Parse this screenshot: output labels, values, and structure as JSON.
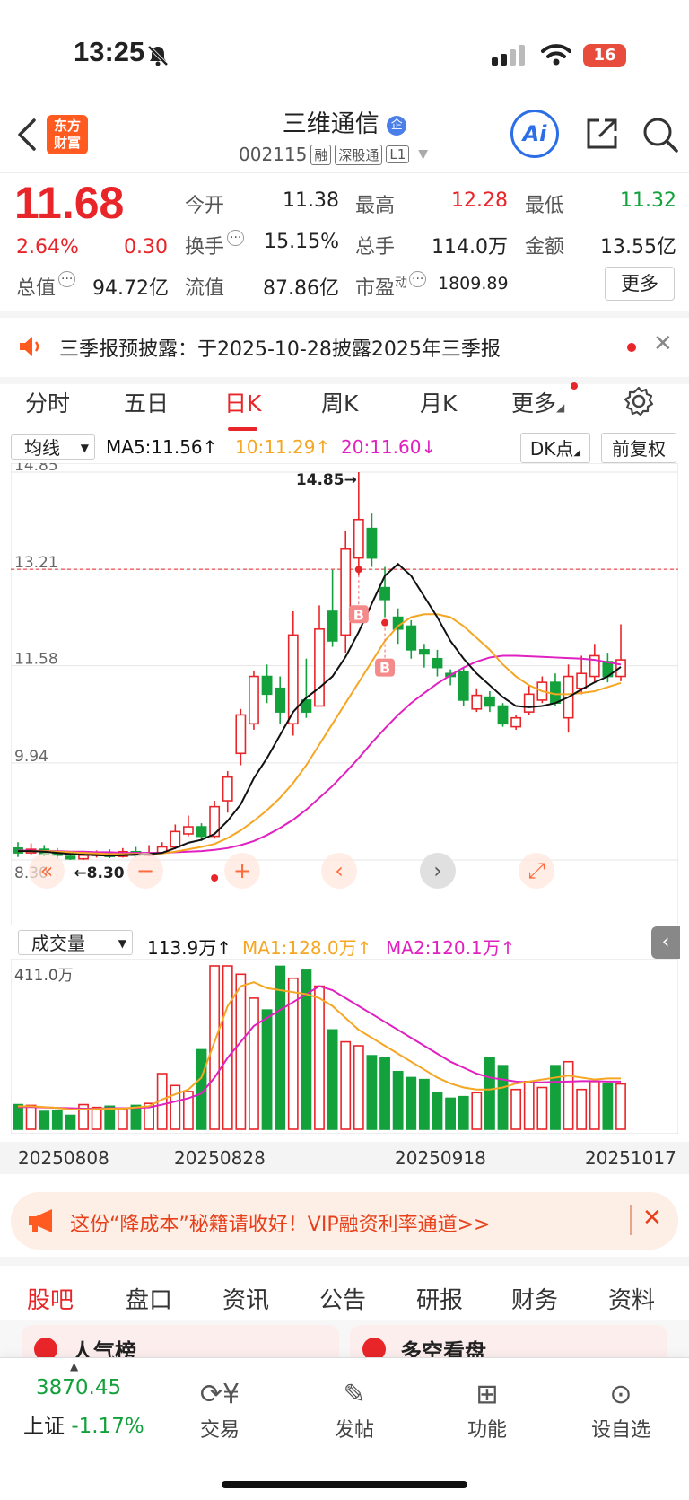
{
  "status": {
    "time": "13:25",
    "battery": "16"
  },
  "header": {
    "logo": "东方\n财富",
    "logo_line1": "东方",
    "logo_line2": "财富",
    "name": "三维通信",
    "code": "002115",
    "tags": [
      "融",
      "深股通",
      "L1"
    ],
    "ai_label": "Ai"
  },
  "quote": {
    "price": "11.68",
    "change_pct": "2.64%",
    "change": "0.30",
    "open_label": "今开",
    "open": "11.38",
    "high_label": "最高",
    "high": "12.28",
    "low_label": "最低",
    "low": "11.32",
    "turnover_label": "换手",
    "turnover": "15.15%",
    "volume_label": "总手",
    "volume": "114.0万",
    "amount_label": "金额",
    "amount": "13.55亿",
    "total_mv_label": "总值",
    "total_mv": "94.72亿",
    "float_mv_label": "流值",
    "float_mv": "87.86亿",
    "pe_label": "市盈",
    "pe_sup": "动",
    "pe": "1809.89",
    "more": "更多"
  },
  "notice": {
    "text": "三季报预披露：于2025-10-28披露2025年三季报"
  },
  "chart_tabs": [
    "分时",
    "五日",
    "日K",
    "周K",
    "月K",
    "更多"
  ],
  "ma_row": {
    "dropdown": "均线",
    "ma5": "MA5:11.56↑",
    "ma10": "10:11.29↑",
    "ma20": "20:11.60↓",
    "dk": "DK点",
    "fq": "前复权"
  },
  "colors": {
    "up": "#e8262a",
    "down": "#13a13c",
    "ma5": "#111111",
    "ma10": "#f5a623",
    "ma20": "#e020c0"
  },
  "chart_data": {
    "type": "candlestick",
    "y_ticks": [
      "14.85",
      "13.21",
      "11.58",
      "9.94",
      "8.30"
    ],
    "ylim": [
      8.3,
      14.85
    ],
    "price_line": 13.21,
    "high_annotation": "14.85→",
    "low_annotation": "←8.30",
    "markers": [
      "B",
      "B"
    ],
    "candles": [
      [
        8.5,
        8.42,
        8.6,
        8.35
      ],
      [
        8.42,
        8.48,
        8.58,
        8.38
      ],
      [
        8.48,
        8.4,
        8.55,
        8.36
      ],
      [
        8.42,
        8.38,
        8.5,
        8.32
      ],
      [
        8.36,
        8.32,
        8.42,
        8.3
      ],
      [
        8.32,
        8.38,
        8.45,
        8.3
      ],
      [
        8.38,
        8.4,
        8.46,
        8.34
      ],
      [
        8.42,
        8.36,
        8.48,
        8.33
      ],
      [
        8.36,
        8.44,
        8.5,
        8.34
      ],
      [
        8.44,
        8.38,
        8.52,
        8.35
      ],
      [
        8.38,
        8.42,
        8.55,
        8.36
      ],
      [
        8.42,
        8.52,
        8.6,
        8.4
      ],
      [
        8.52,
        8.78,
        8.9,
        8.48
      ],
      [
        8.74,
        8.86,
        9.05,
        8.7
      ],
      [
        8.86,
        8.7,
        8.92,
        8.62
      ],
      [
        8.7,
        9.2,
        9.3,
        8.66
      ],
      [
        9.3,
        9.7,
        9.8,
        9.1
      ],
      [
        10.1,
        10.75,
        10.85,
        9.9
      ],
      [
        10.6,
        11.4,
        11.5,
        10.5
      ],
      [
        11.4,
        11.1,
        11.6,
        10.95
      ],
      [
        11.2,
        10.8,
        11.4,
        10.6
      ],
      [
        10.6,
        12.1,
        12.5,
        10.4
      ],
      [
        11.0,
        10.8,
        11.7,
        10.7
      ],
      [
        10.9,
        12.2,
        12.6,
        10.9
      ],
      [
        12.5,
        12.0,
        13.2,
        11.9
      ],
      [
        12.1,
        13.55,
        13.85,
        11.8
      ],
      [
        13.4,
        14.05,
        14.85,
        13.1
      ],
      [
        13.9,
        13.4,
        14.15,
        13.25
      ],
      [
        12.9,
        12.7,
        13.25,
        12.4
      ],
      [
        12.4,
        12.2,
        12.55,
        11.95
      ],
      [
        12.25,
        11.85,
        12.35,
        11.7
      ],
      [
        11.85,
        11.78,
        11.95,
        11.55
      ],
      [
        11.7,
        11.55,
        11.85,
        11.4
      ],
      [
        11.45,
        11.4,
        11.52,
        11.25
      ],
      [
        11.48,
        11.0,
        11.55,
        10.9
      ],
      [
        10.85,
        11.08,
        11.2,
        10.8
      ],
      [
        11.05,
        10.9,
        11.15,
        10.8
      ],
      [
        10.9,
        10.6,
        10.95,
        10.55
      ],
      [
        10.55,
        10.7,
        10.75,
        10.5
      ],
      [
        10.8,
        11.1,
        11.25,
        10.75
      ],
      [
        11.0,
        11.3,
        11.4,
        10.95
      ],
      [
        11.3,
        10.95,
        11.45,
        10.9
      ],
      [
        10.7,
        11.4,
        11.6,
        10.45
      ],
      [
        11.2,
        11.45,
        11.75,
        11.1
      ],
      [
        11.4,
        11.75,
        11.95,
        11.3
      ],
      [
        11.65,
        11.4,
        11.8,
        11.3
      ],
      [
        11.4,
        11.68,
        12.28,
        11.32
      ]
    ],
    "ma5": [
      8.45,
      8.45,
      8.44,
      8.42,
      8.4,
      8.39,
      8.38,
      8.37,
      8.38,
      8.39,
      8.4,
      8.42,
      8.5,
      8.59,
      8.64,
      8.74,
      8.96,
      9.24,
      9.68,
      10.02,
      10.41,
      10.8,
      11.04,
      11.21,
      11.4,
      11.73,
      12.15,
      12.63,
      13.1,
      13.3,
      13.1,
      12.75,
      12.4,
      12.0,
      11.7,
      11.45,
      11.25,
      11.05,
      10.9,
      10.88,
      10.9,
      10.95,
      11.05,
      11.18,
      11.3,
      11.4,
      11.56
    ],
    "ma10": [
      8.45,
      8.45,
      8.45,
      8.44,
      8.43,
      8.42,
      8.41,
      8.4,
      8.4,
      8.4,
      8.4,
      8.41,
      8.44,
      8.48,
      8.52,
      8.57,
      8.67,
      8.8,
      8.96,
      9.14,
      9.35,
      9.6,
      9.9,
      10.25,
      10.6,
      10.95,
      11.3,
      11.65,
      12.0,
      12.25,
      12.4,
      12.45,
      12.45,
      12.4,
      12.25,
      12.05,
      11.85,
      11.6,
      11.4,
      11.25,
      11.15,
      11.1,
      11.1,
      11.12,
      11.15,
      11.22,
      11.29
    ],
    "ma20": [
      8.46,
      8.46,
      8.45,
      8.45,
      8.44,
      8.44,
      8.43,
      8.43,
      8.42,
      8.42,
      8.42,
      8.42,
      8.43,
      8.44,
      8.45,
      8.47,
      8.5,
      8.55,
      8.62,
      8.72,
      8.84,
      8.98,
      9.15,
      9.35,
      9.55,
      9.78,
      10.02,
      10.28,
      10.52,
      10.75,
      10.95,
      11.12,
      11.28,
      11.42,
      11.55,
      11.65,
      11.72,
      11.75,
      11.75,
      11.74,
      11.73,
      11.72,
      11.71,
      11.7,
      11.68,
      11.64,
      11.6
    ]
  },
  "vol_row": {
    "dropdown": "成交量",
    "vol": "113.9万↑",
    "ma1": "MA1:128.0万↑",
    "ma2": "MA2:120.1万↑"
  },
  "vol_chart": {
    "max_label": "411.0万",
    "max": 411.0,
    "bars": [
      62,
      60,
      45,
      48,
      35,
      62,
      55,
      58,
      50,
      60,
      65,
      140,
      110,
      95,
      200,
      411,
      411,
      390,
      330,
      300,
      410,
      380,
      400,
      360,
      250,
      220,
      210,
      185,
      180,
      145,
      130,
      125,
      92,
      78,
      82,
      92,
      180,
      160,
      100,
      120,
      105,
      160,
      170,
      100,
      120,
      113.9,
      113.9
    ],
    "ma1": [
      58,
      58,
      56,
      54,
      50,
      50,
      51,
      52,
      52,
      55,
      58,
      75,
      88,
      100,
      130,
      220,
      310,
      360,
      370,
      355,
      350,
      345,
      340,
      330,
      310,
      280,
      250,
      230,
      210,
      190,
      170,
      150,
      130,
      115,
      105,
      100,
      100,
      105,
      115,
      120,
      125,
      130,
      135,
      130,
      125,
      128,
      128
    ],
    "ma2": [
      56,
      56,
      55,
      54,
      53,
      52,
      52,
      53,
      53,
      54,
      55,
      62,
      70,
      78,
      90,
      130,
      180,
      220,
      260,
      280,
      300,
      320,
      340,
      360,
      350,
      330,
      310,
      290,
      270,
      250,
      230,
      210,
      190,
      170,
      155,
      140,
      130,
      125,
      120,
      118,
      118,
      119,
      120,
      121,
      121,
      120,
      120
    ]
  },
  "dates": [
    "20250808",
    "20250828",
    "20250918",
    "20251017"
  ],
  "ad": {
    "text": "这份“降成本”秘籍请收好！VIP融资利率通道>>"
  },
  "bottom_tabs": [
    "股吧",
    "盘口",
    "资讯",
    "公告",
    "研报",
    "财务",
    "资料"
  ],
  "cards": [
    "人气榜",
    "多空看盘"
  ],
  "bottom_nav": {
    "index_value": "3870.45",
    "index_name": "上证",
    "index_change": "-1.17%",
    "items": [
      "交易",
      "发帖",
      "功能",
      "设自选"
    ]
  }
}
